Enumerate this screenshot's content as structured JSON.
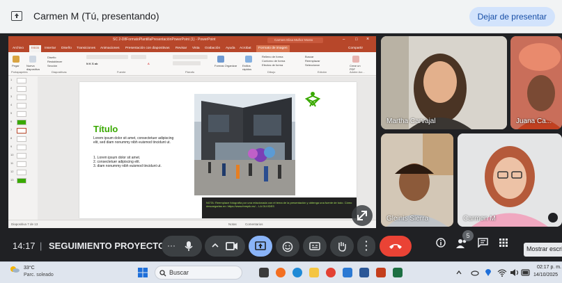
{
  "topbar": {
    "presenting_title": "Carmen M (Tú, presentando)",
    "stop_button": "Dejar de presentar"
  },
  "ppt": {
    "doc_name": "SC 2-D8FormatoPlantillaPresentaciónPowerPoint (1) - PowerPoint",
    "search_placeholder": "Carmen Elisa Muñoz Mosto",
    "tabs": [
      "Archivo",
      "Inicio",
      "Insertar",
      "Diseño",
      "Transiciones",
      "Animaciones",
      "Presentación con diapositivas",
      "Revisar",
      "Vista",
      "Grabación",
      "Ayuda",
      "Acrobat",
      "Formato de imagen",
      "Compartir"
    ],
    "ribbon_groups": [
      "Portapapeles",
      "Diapositivas",
      "Fuente",
      "Párrafo",
      "Dibujo",
      "Edición",
      "Adobe Acr..."
    ],
    "ribbon_labels": {
      "paste": "Pegar",
      "new_slide": "Nueva diapositiva",
      "design": "Diseño",
      "reset": "Restablecer",
      "section": "Sección",
      "shapes_format": "Formas Organizar",
      "quick_styles": "Estilos rápidos",
      "fill": "Relleno de forma",
      "outline": "Contorno de forma",
      "effects": "Efectos de forma",
      "find": "Buscar",
      "replace": "Reemplazar",
      "select": "Seleccionar",
      "pdf": "Crear un PDF"
    },
    "slide": {
      "title": "Título",
      "body": "Lorem ipsum dolor sit amet, consectetuer adipiscing elit, sed diam nonummy nibh euismod tincidunt ut.",
      "list": [
        "1. Lorem ipsum dolor sit amet.",
        "2. consectetuer adipiscing elit.",
        "3. diam nonummy nibh euismod tincidunt ut."
      ],
      "caption": "NOTA: Reemplace fotografía por una relacionada con el tema de la presentación y obtenga una fuente de todo. Cómo descargarlas en: https://www.freepik.es/... LA OLVIDES"
    },
    "status_left": "Diapositiva 7 de 13",
    "status_notes": "Notas",
    "status_comments": "Comentarios"
  },
  "participants": [
    {
      "name": "Martha Carvajal"
    },
    {
      "name": "Juana Ca..."
    },
    {
      "name": "Gleinis Sierra"
    },
    {
      "name": "Carmen M"
    }
  ],
  "controls": {
    "time": "14:17",
    "separator": "|",
    "meeting_name": "SEGUIMIENTO PROYECTO GLEN...",
    "participants_count": "5",
    "tooltip": "Mostrar escritorio"
  },
  "taskbar": {
    "temperature": "33°C",
    "condition": "Parc. soleado",
    "search": "Buscar",
    "time": "02:17 p. m.",
    "date": "14/10/2025"
  },
  "colors": {
    "ppt_accent": "#b7472a",
    "sena_green": "#39a900",
    "end_call": "#ea4335",
    "present_active": "#8ab4f8"
  }
}
